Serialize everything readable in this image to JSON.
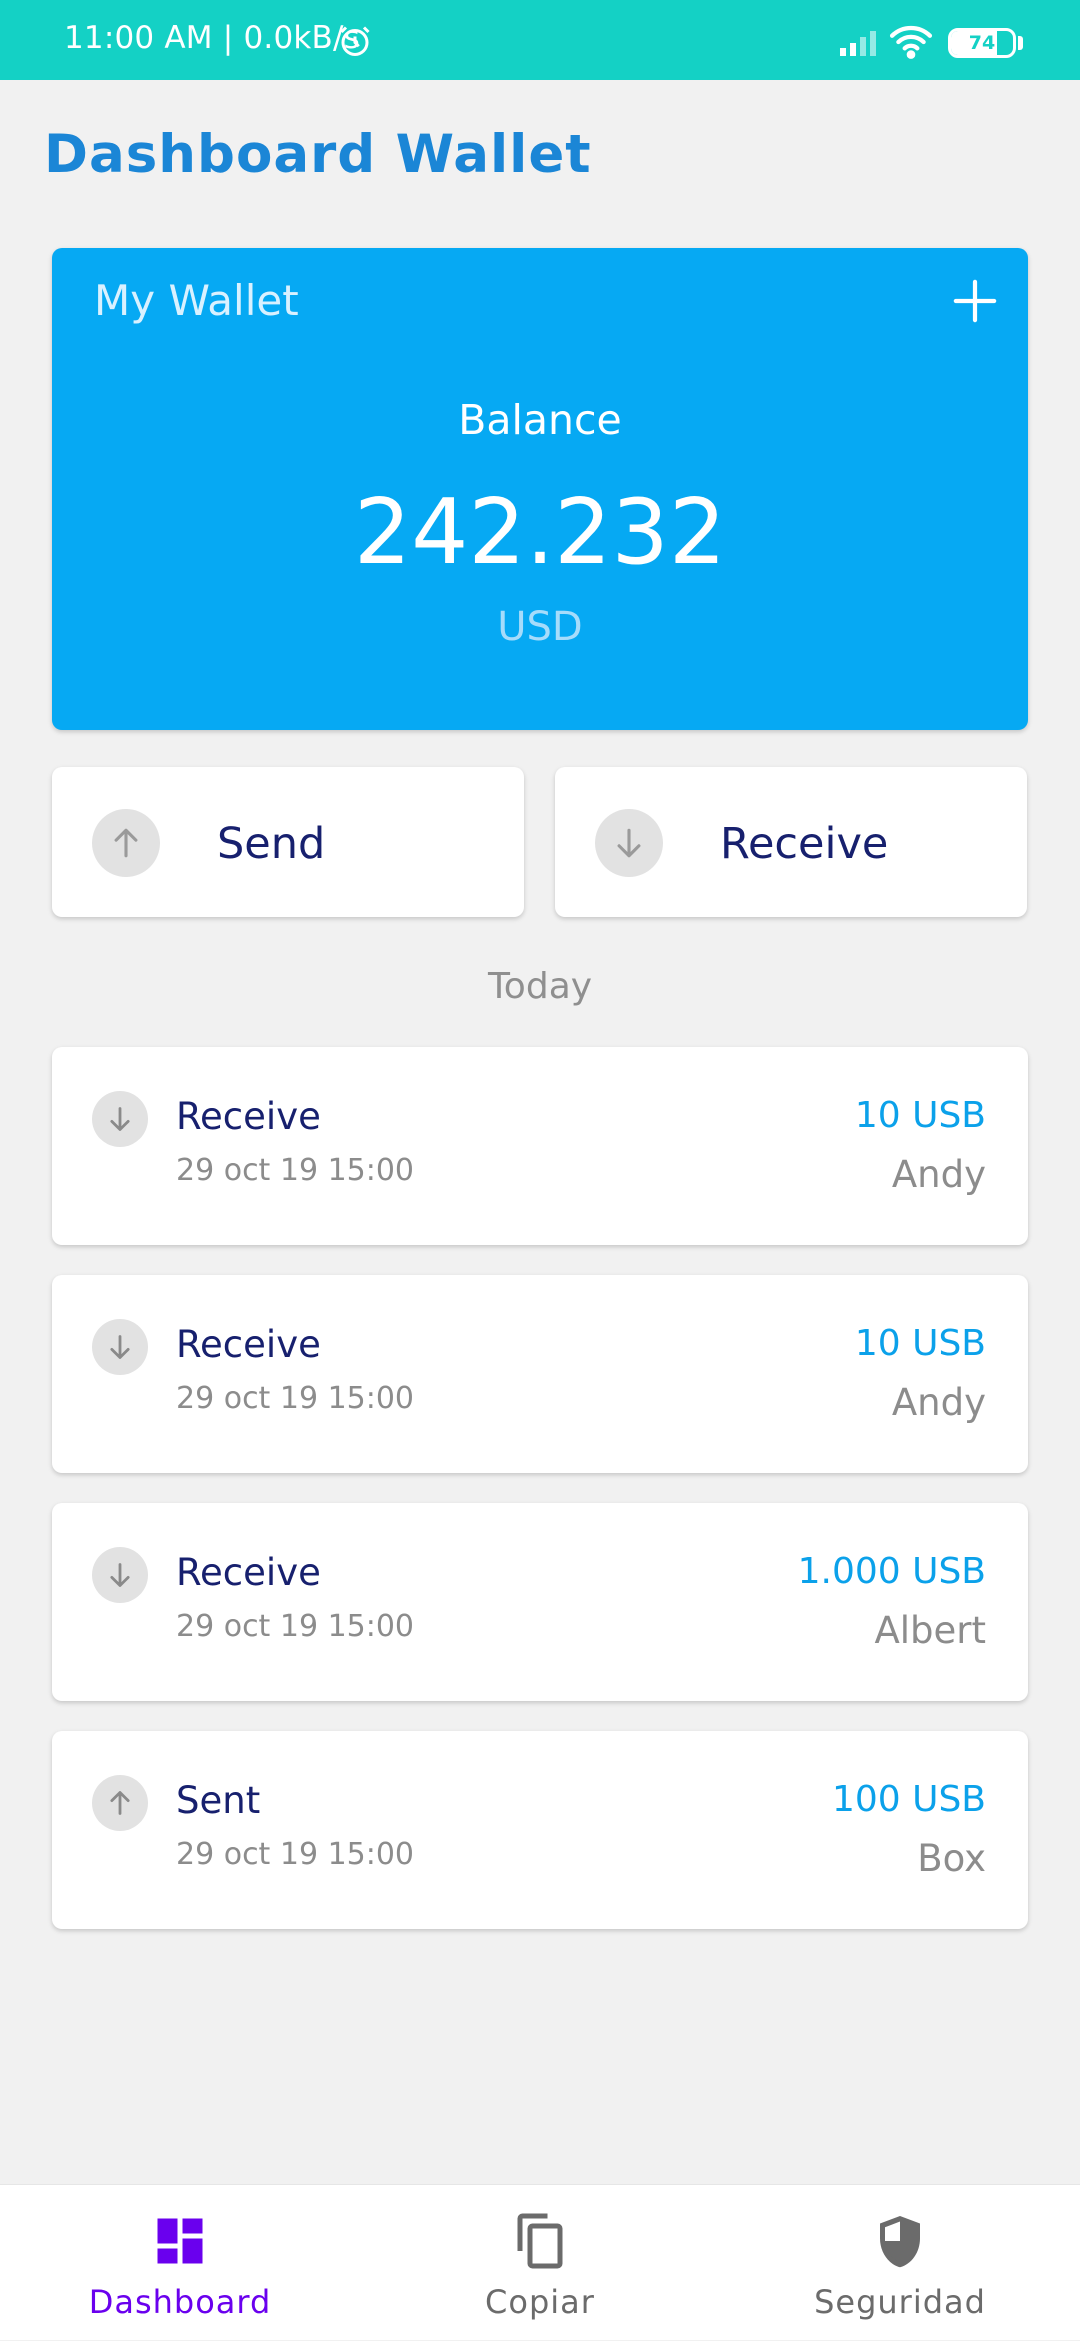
{
  "status_bar": {
    "time_network": "11:00 AM | 0.0kB/s",
    "alarm_icon": "alarm-clock-icon",
    "signal_icon": "cellular-signal-icon",
    "wifi_icon": "wifi-icon",
    "battery": "74",
    "battery_level": 0.74
  },
  "header": {
    "title": "Dashboard Wallet"
  },
  "wallet": {
    "name": "My Wallet",
    "add_icon": "plus-icon",
    "balance_label": "Balance",
    "balance_value": "242.232",
    "currency": "USD"
  },
  "actions": {
    "send_label": "Send",
    "send_icon": "arrow-up-icon",
    "receive_label": "Receive",
    "receive_icon": "arrow-down-icon"
  },
  "section": {
    "today": "Today"
  },
  "transactions": [
    {
      "direction": "down",
      "type": "Receive",
      "date": "29 oct 19 15:00",
      "amount": "10 USB",
      "person": "Andy"
    },
    {
      "direction": "down",
      "type": "Receive",
      "date": "29 oct 19 15:00",
      "amount": "10 USB",
      "person": "Andy"
    },
    {
      "direction": "down",
      "type": "Receive",
      "date": "29 oct 19 15:00",
      "amount": "1.000 USB",
      "person": "Albert"
    },
    {
      "direction": "up",
      "type": "Sent",
      "date": "29 oct 19 15:00",
      "amount": "100 USB",
      "person": "Box"
    }
  ],
  "bottom_nav": {
    "items": [
      {
        "label": "Dashboard",
        "icon": "dashboard-icon",
        "active": true
      },
      {
        "label": "Copiar",
        "icon": "copy-icon",
        "active": false
      },
      {
        "label": "Seguridad",
        "icon": "shield-icon",
        "active": false
      }
    ]
  },
  "colors": {
    "status_bar": "#14d1c5",
    "title": "#1b86d6",
    "wallet_card": "#06a9f3",
    "amount": "#0ba1ea",
    "primary_text": "#17206e",
    "nav_active": "#6a00ee",
    "nav_inactive": "#6b6b6b"
  }
}
